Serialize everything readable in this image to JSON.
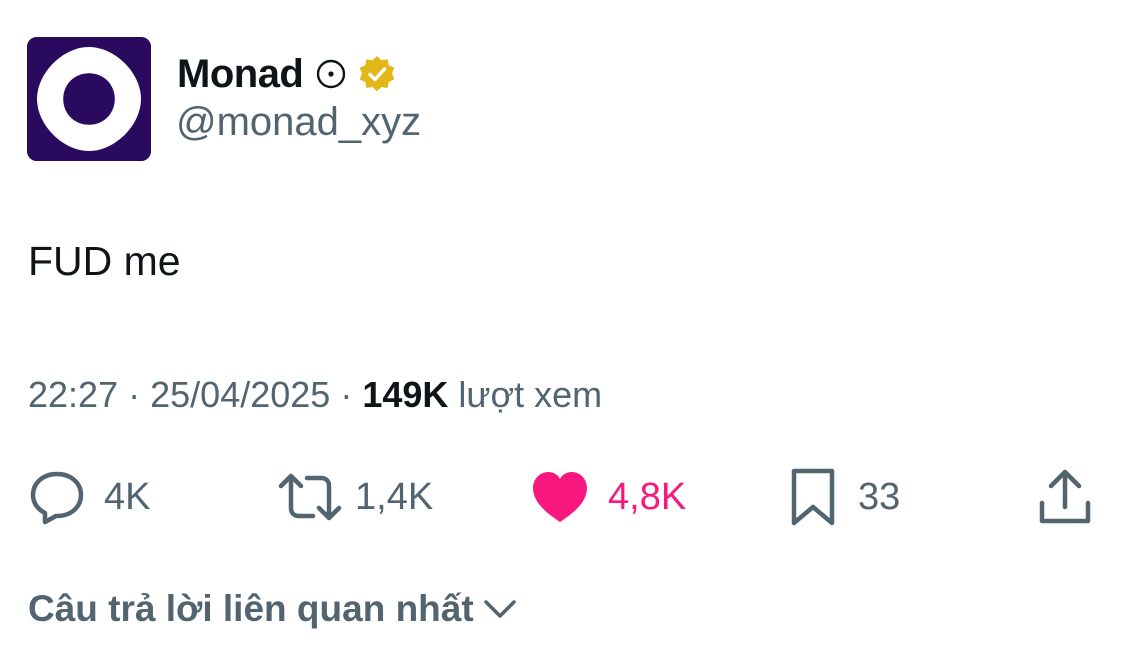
{
  "author": {
    "display_name": "Monad",
    "handle": "@monad_xyz",
    "avatar_icon": "monad-logo",
    "affiliate_icon": "circle-dot-icon",
    "verified_icon": "gold-verified-badge",
    "avatar_bg": "#2a0a5e",
    "badge_color": "#e2b719"
  },
  "tweet": {
    "text": "FUD me",
    "time": "22:27",
    "separator": "·",
    "date": "25/04/2025",
    "views_count": "149K",
    "views_label": "lượt xem"
  },
  "actions": {
    "reply": {
      "icon": "reply-icon",
      "count": "4K"
    },
    "retweet": {
      "icon": "retweet-icon",
      "count": "1,4K"
    },
    "like": {
      "icon": "heart-icon",
      "count": "4,8K",
      "active": true,
      "color": "#f91880"
    },
    "bookmark": {
      "icon": "bookmark-icon",
      "count": "33"
    },
    "share": {
      "icon": "share-icon"
    }
  },
  "replies_sort": {
    "label": "Câu trả lời liên quan nhất",
    "icon": "chevron-down-icon"
  }
}
